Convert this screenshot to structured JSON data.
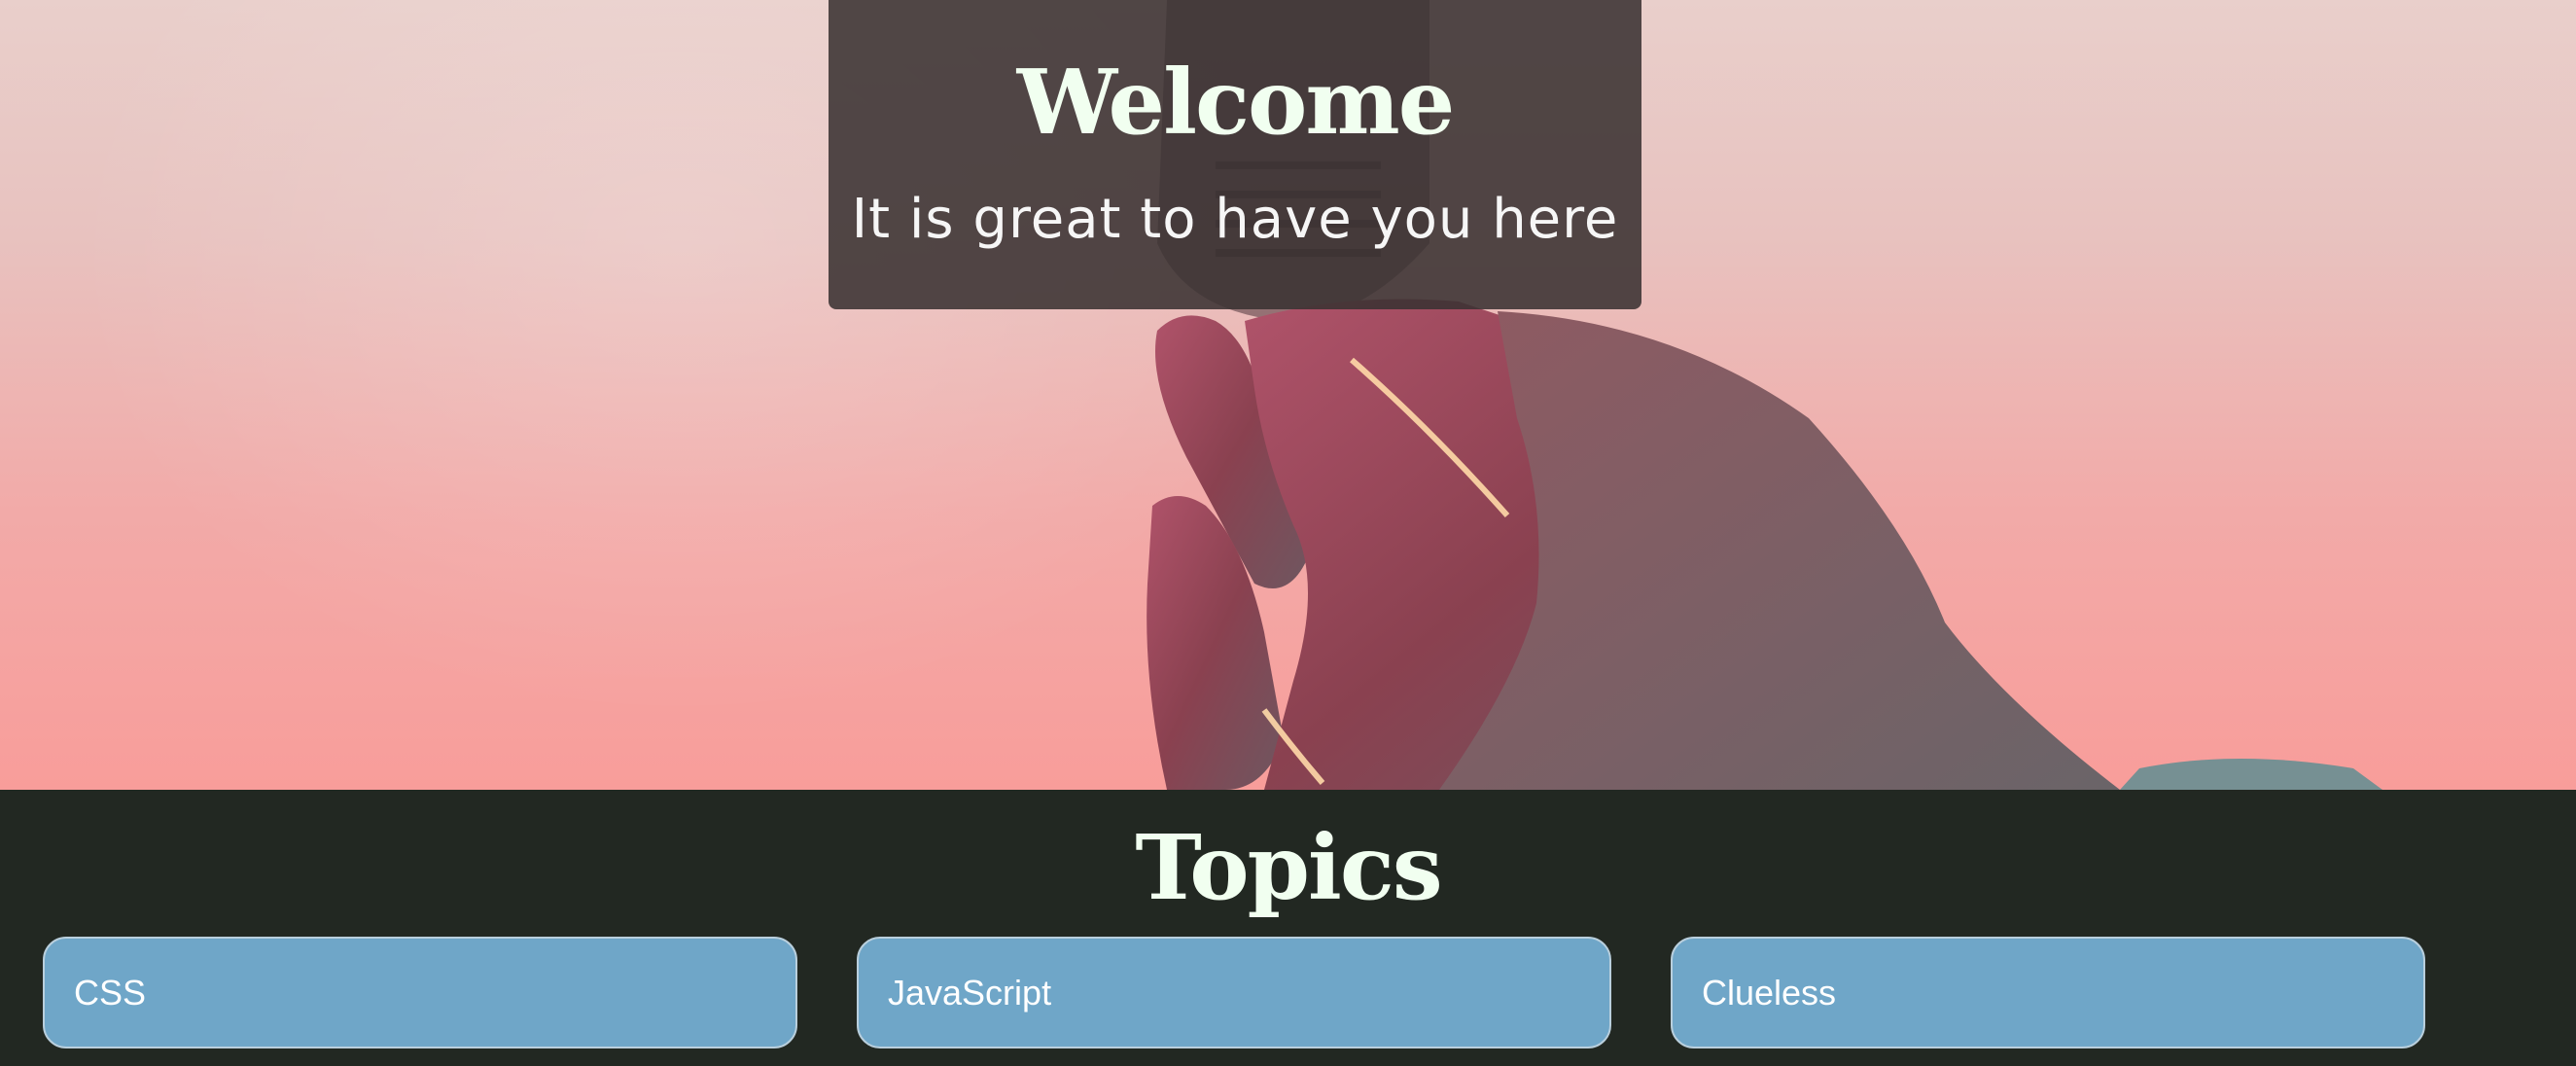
{
  "hero": {
    "welcome_title": "Welcome",
    "welcome_subtitle": "It is great to have you here",
    "background_image": "hand-holding-lightbulb-sunset"
  },
  "topics": {
    "title": "Topics",
    "items": [
      {
        "label": "CSS"
      },
      {
        "label": "JavaScript"
      },
      {
        "label": "Clueless"
      }
    ]
  },
  "colors": {
    "heading_text": "#f1fff0",
    "dark_background": "#222822",
    "card_background": "#6fa6c8",
    "overlay": "#3a3232"
  }
}
